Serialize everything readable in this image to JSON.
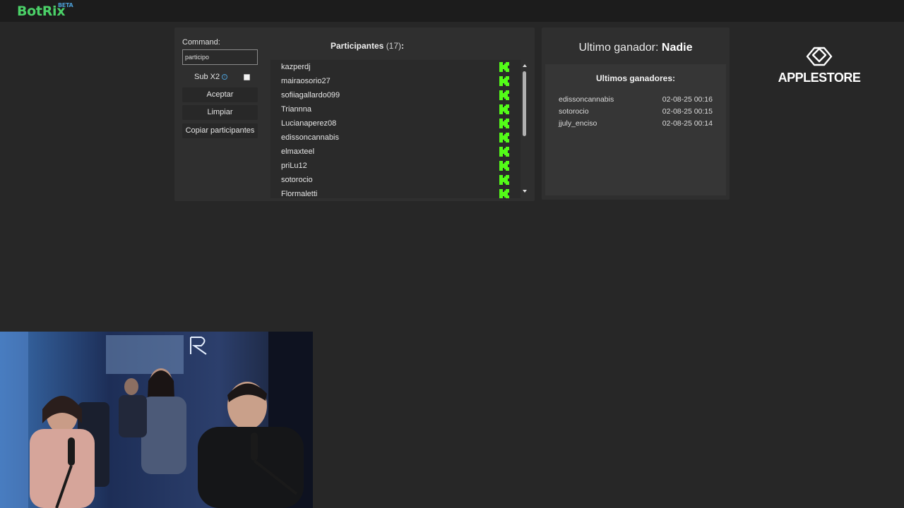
{
  "brand": {
    "name": "BotRix",
    "tag": "BETA"
  },
  "command": {
    "label": "Command:",
    "value": "participo"
  },
  "sub_option": {
    "label": "Sub X2",
    "checked": false
  },
  "buttons": {
    "accept": "Aceptar",
    "clear": "Limpiar",
    "copy": "Copiar participantes"
  },
  "participants": {
    "title": "Participantes",
    "count": "(17)",
    "colon": ":",
    "items": [
      "kazperdj",
      "mairaosorio27",
      "sofiiagallardo099",
      "Triannna",
      "Lucianaperez08",
      "edissoncannabis",
      "elmaxteel",
      "priLu12",
      "sotorocio",
      "Flormaletti"
    ]
  },
  "last_winner": {
    "label": "Ultimo ganador:",
    "value": "Nadie"
  },
  "winners": {
    "title": "Ultimos ganadores:",
    "rows": [
      {
        "name": "edissoncannabis",
        "date": "02-08-25 00:16"
      },
      {
        "name": "sotorocio",
        "date": "02-08-25 00:15"
      },
      {
        "name": "jjuly_enciso",
        "date": "02-08-25 00:14"
      }
    ]
  },
  "sponsor": {
    "name": "APPLESTORE"
  },
  "colors": {
    "kick_green": "#53fc18",
    "brand_green": "#4bd168",
    "beta_blue": "#4b9bd1"
  },
  "icons": {
    "platform": "kick-icon",
    "info": "info-icon",
    "sponsor": "applestore-logo-icon"
  }
}
